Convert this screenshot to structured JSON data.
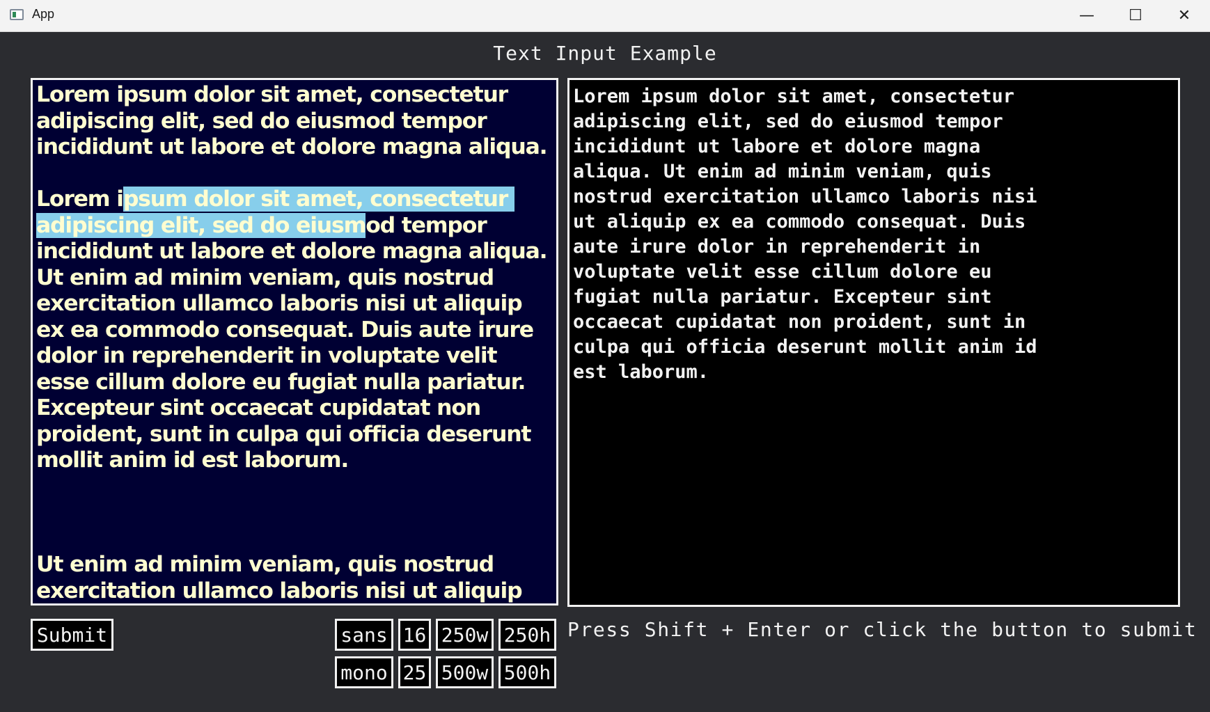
{
  "window": {
    "title": "App",
    "minimize_glyph": "—",
    "maximize_glyph": "☐",
    "close_glyph": "✕"
  },
  "heading": "Text Input Example",
  "left_editor": {
    "paragraphs": [
      {
        "before": "Lorem ipsum dolor sit amet, consectetur adipiscing elit, sed do eiusmod tempor incididunt ut labore et dolore magna aliqua.",
        "selected": "",
        "after": ""
      },
      {
        "before": "Lorem i",
        "selected": "psum dolor sit amet, consectetur adipiscing elit, sed do eiusm",
        "after": "od tempor incididunt ut labore et dolore magna aliqua. Ut enim ad minim veniam, quis nostrud exercitation ullamco laboris nisi ut aliquip ex ea commodo consequat. Duis aute irure dolor in reprehenderit in voluptate velit esse cillum dolore eu fugiat nulla pariatur. Excepteur sint occaecat cupidatat non proident, sunt in culpa qui officia deserunt mollit anim id est laborum."
      },
      {
        "before": "",
        "selected": "",
        "after": ""
      },
      {
        "before": "Ut enim ad minim veniam, quis nostrud exercitation ullamco laboris nisi ut aliquip",
        "selected": "",
        "after": ""
      }
    ],
    "background": "#000033",
    "text_color": "#fffdd0",
    "selection_color": "#87ceeb"
  },
  "right_editor": {
    "text": "Lorem ipsum dolor sit amet, consectetur\nadipiscing elit, sed do eiusmod tempor\nincididunt ut labore et dolore magna\naliqua. Ut enim ad minim veniam, quis\nnostrud exercitation ullamco laboris nisi\nut aliquip ex ea commodo consequat. Duis\naute irure dolor in reprehenderit in\nvoluptate velit esse cillum dolore eu\nfugiat nulla pariatur. Excepteur sint\noccaecat cupidatat non proident, sunt in\nculpa qui officia deserunt mollit anim id\nest laborum."
  },
  "buttons": {
    "submit": "Submit",
    "sans": "sans",
    "mono": "mono",
    "size_16": "16",
    "size_25": "25",
    "w250": "250w",
    "w500": "500w",
    "h250": "250h",
    "h500": "500h"
  },
  "hint": "Press Shift + Enter or click the button to submit"
}
